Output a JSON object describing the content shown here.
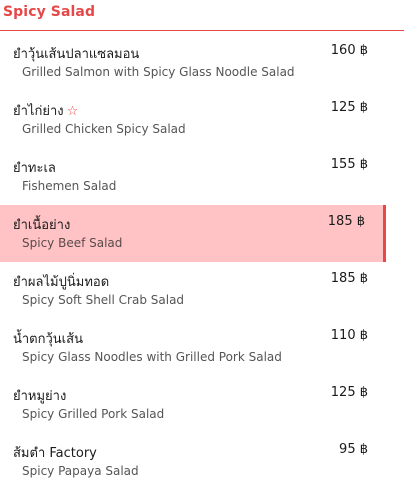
{
  "section": {
    "title": "Spicy Salad"
  },
  "colors": {
    "accent": "#e64848",
    "highlight_bg": "#ffc3c5"
  },
  "items": [
    {
      "thai": "ยำวุ้นเส้นปลาแซลมอน",
      "english": "Grilled Salmon with Spicy Glass Noodle Salad",
      "price": "160 ฿"
    },
    {
      "thai": "ยำไก่ย่าง",
      "english": "Grilled Chicken Spicy Salad",
      "price": "125 ฿",
      "icon": "star-icon"
    },
    {
      "thai": "ยำทะเล",
      "english": "Fishemen Salad",
      "price": "155 ฿"
    },
    {
      "thai": "ยำเนื้อย่าง",
      "english": "Spicy Beef Salad",
      "price": "185 ฿",
      "selected": true
    },
    {
      "thai": "ยำผลไม้ปูนิ่มทอด",
      "english": "Spicy Soft Shell Crab Salad",
      "price": "185 ฿"
    },
    {
      "thai": "น้ำตกวุ้นเส้น",
      "english": "Spicy Glass Noodles with Grilled Pork Salad",
      "price": "110 ฿"
    },
    {
      "thai": "ยำหมูย่าง",
      "english": "Spicy Grilled Pork Salad",
      "price": "125 ฿"
    },
    {
      "thai": "ส้มตำ Factory",
      "english": "Spicy Papaya Salad",
      "price": "95 ฿"
    }
  ]
}
